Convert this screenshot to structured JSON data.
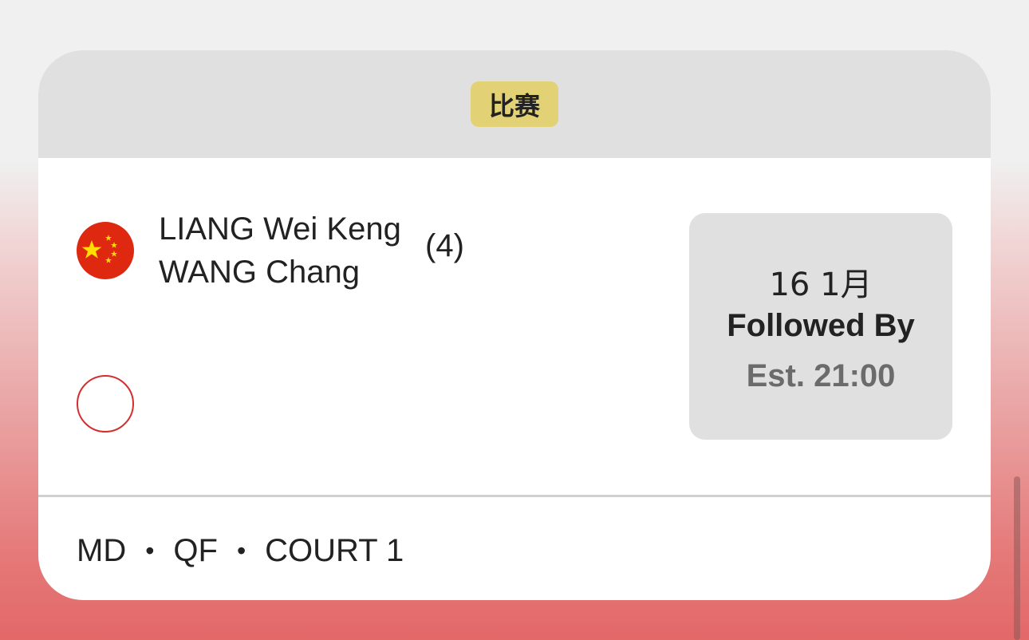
{
  "card": {
    "header_badge": "比赛",
    "team1": {
      "flag_icon": "china-flag-icon",
      "players": [
        "LIANG Wei Keng",
        "WANG Chang"
      ],
      "seed": "(4)"
    },
    "team2": {
      "flag_icon": "empty-flag-placeholder-icon"
    },
    "schedule": {
      "date": "16 1月",
      "status": "Followed By",
      "estimate": "Est. 21:00"
    },
    "footer": {
      "event": "MD",
      "round": "QF",
      "court": "COURT 1",
      "separator": "•"
    }
  },
  "colors": {
    "badge": "#e3d176",
    "header": "#e0e0e0",
    "flag_red": "#de2910",
    "flag_star": "#ffde00",
    "empty_circle": "#d32f2f"
  }
}
